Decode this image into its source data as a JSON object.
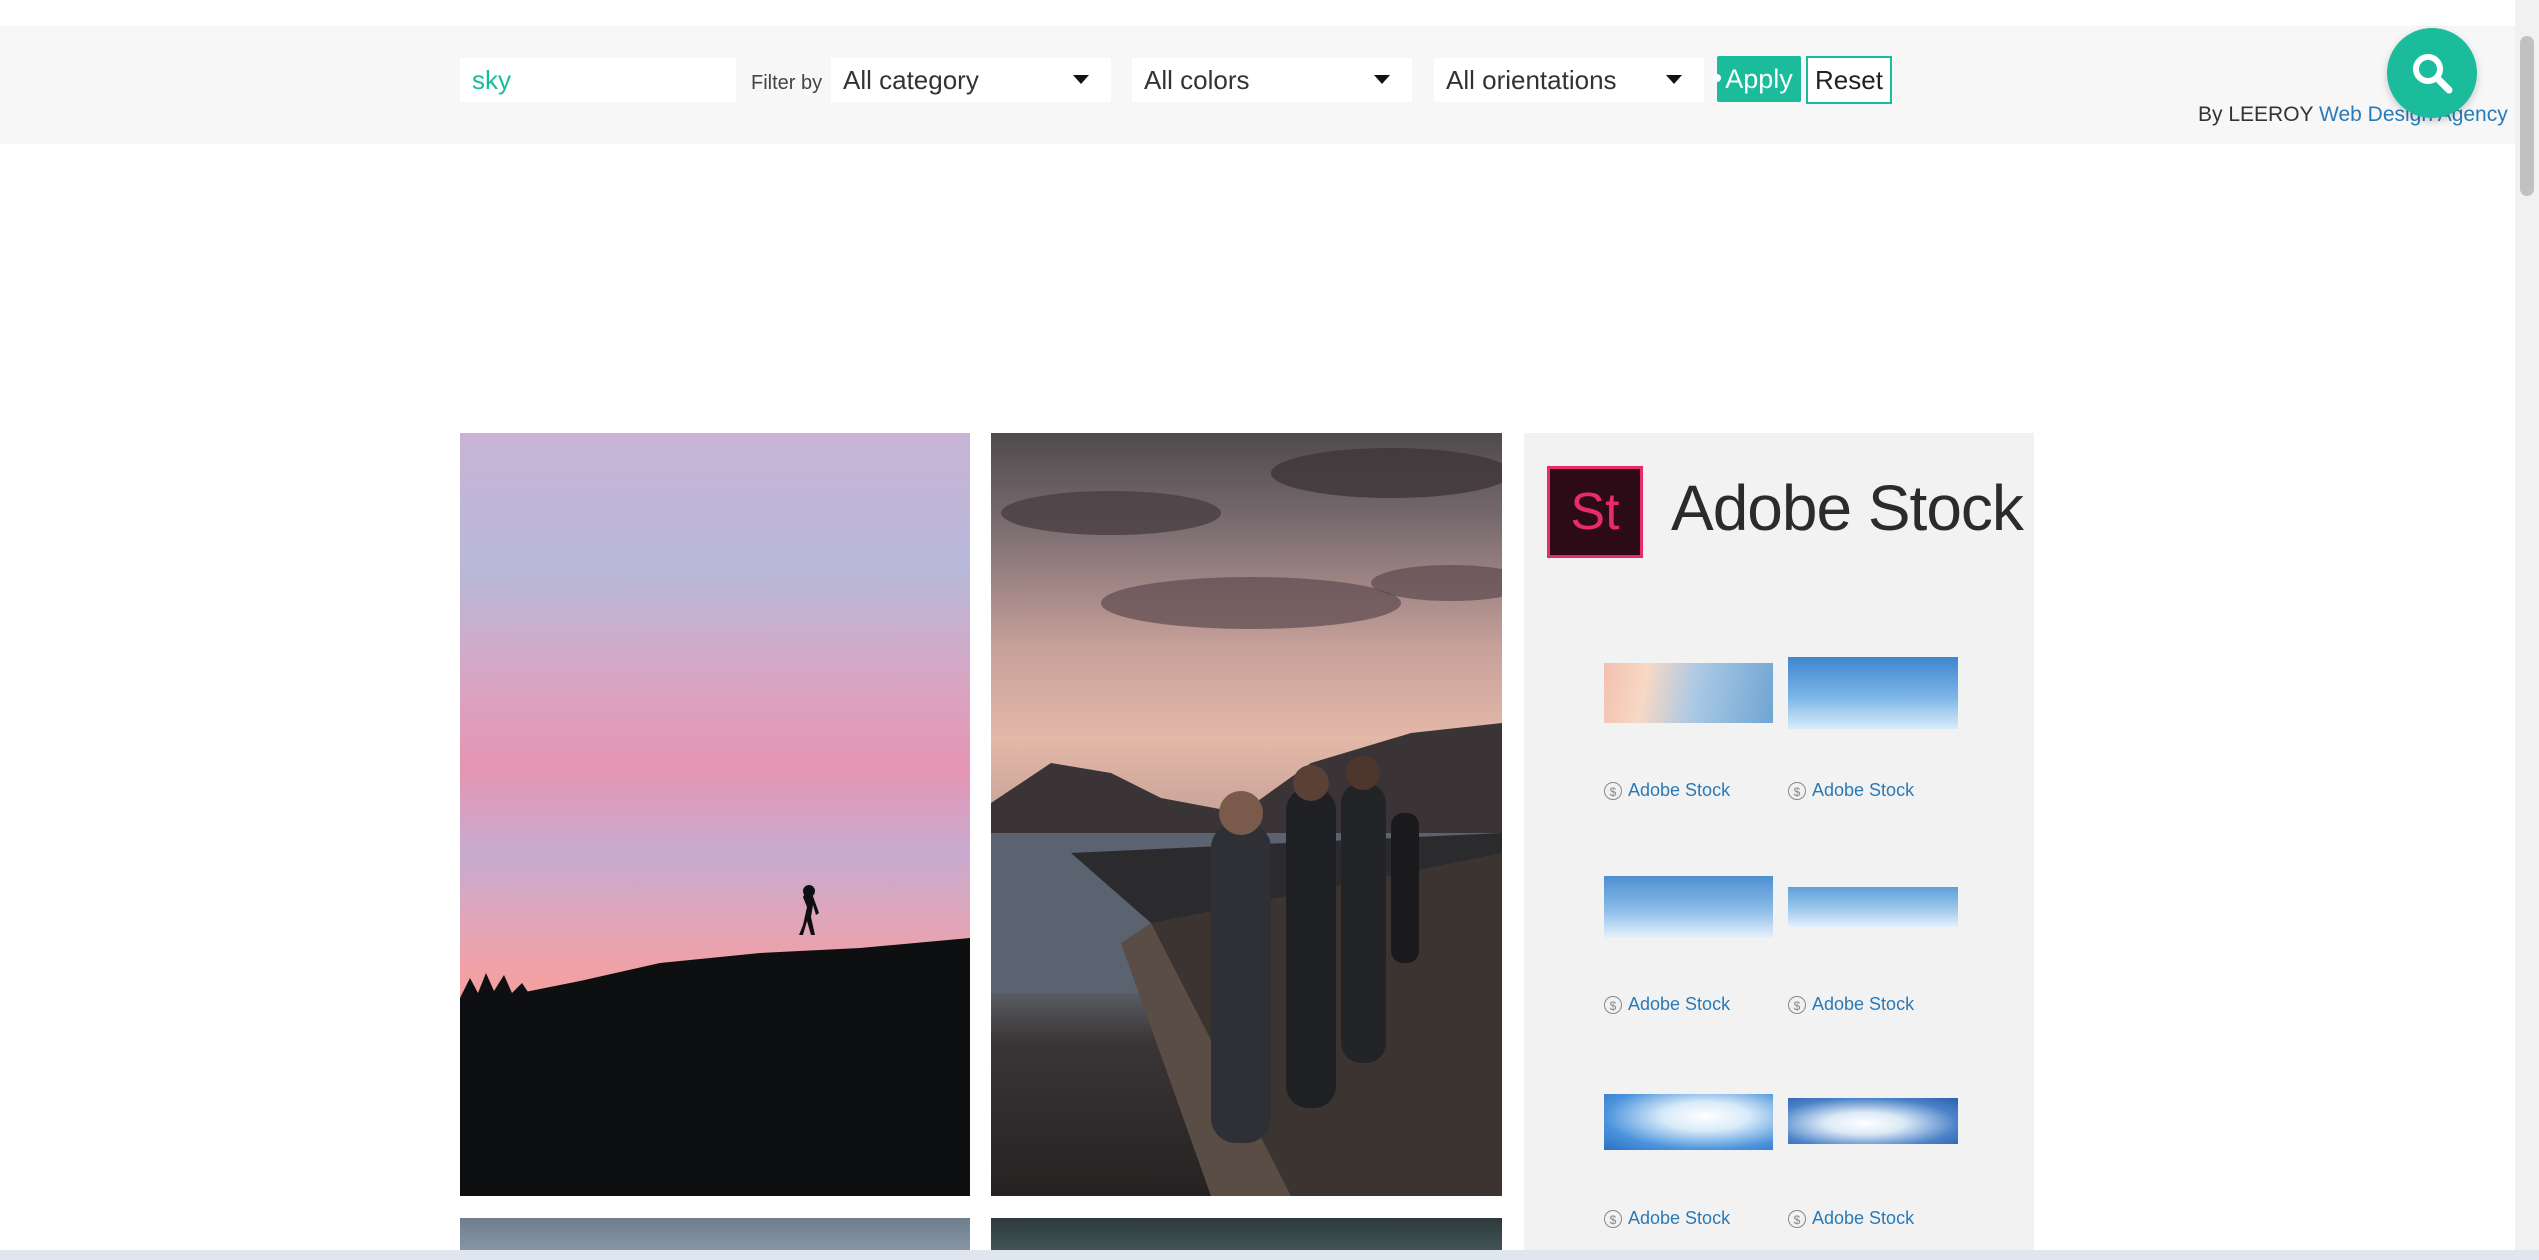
{
  "search": {
    "value": "sky"
  },
  "filters": {
    "label": "Filter by",
    "category": "All category",
    "colors": "All colors",
    "orientations": "All orientations",
    "apply_label": "Apply",
    "reset_label": "Reset"
  },
  "credit": {
    "prefix": "By LEEROY",
    "link": "Web Design Agency"
  },
  "adobe": {
    "logo_text": "St",
    "title": "Adobe Stock",
    "items": [
      {
        "label": "Adobe Stock"
      },
      {
        "label": "Adobe Stock"
      },
      {
        "label": "Adobe Stock"
      },
      {
        "label": "Adobe Stock"
      },
      {
        "label": "Adobe Stock"
      },
      {
        "label": "Adobe Stock"
      }
    ]
  },
  "colors": {
    "accent": "#1abc9c",
    "link": "#2a7ab8",
    "adobe_pink": "#ea2b6b"
  },
  "icons": {
    "fab": "search-icon",
    "stock": "dollar-circle-icon"
  }
}
